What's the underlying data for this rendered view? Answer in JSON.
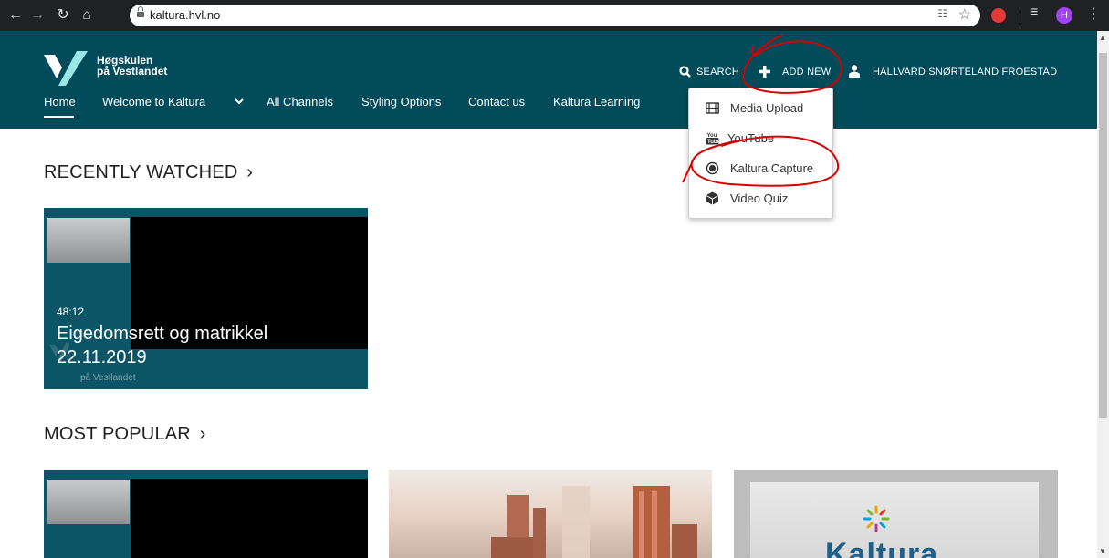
{
  "browser": {
    "url": "kaltura.hvl.no",
    "profile_initial": "H",
    "translate_glyph": "☷"
  },
  "header": {
    "logo_line1": "Høgskulen",
    "logo_line2": "på Vestlandet",
    "search_label": "SEARCH",
    "add_new_label": "ADD NEW",
    "user_name": "HALLVARD SNØRTELAND FROESTAD"
  },
  "nav": {
    "items": [
      {
        "label": "Home"
      },
      {
        "label": "Welcome to Kaltura"
      },
      {
        "label": "All Channels"
      },
      {
        "label": "Styling Options"
      },
      {
        "label": "Contact us"
      },
      {
        "label": "Kaltura Learning"
      }
    ],
    "chevron": "⌄"
  },
  "add_new_menu": {
    "items": [
      {
        "label": "Media Upload",
        "icon": "film-icon"
      },
      {
        "label": "YouTube",
        "icon": "youtube-icon"
      },
      {
        "label": "Kaltura Capture",
        "icon": "record-icon"
      },
      {
        "label": "Video Quiz",
        "icon": "cube-icon"
      }
    ]
  },
  "recently_watched": {
    "title": "RECENTLY WATCHED",
    "arrow": "›",
    "items": [
      {
        "duration": "48:12",
        "title_line1": "Eigedomsrett og matrikkel",
        "title_line2": "22.11.2019",
        "watermark": "på Vestlandet"
      }
    ]
  },
  "most_popular": {
    "title": "MOST POPULAR",
    "arrow": "›",
    "brand_text": "Kaltura"
  },
  "colors": {
    "header_bg": "#024b5a",
    "annotation": "#d60000"
  }
}
